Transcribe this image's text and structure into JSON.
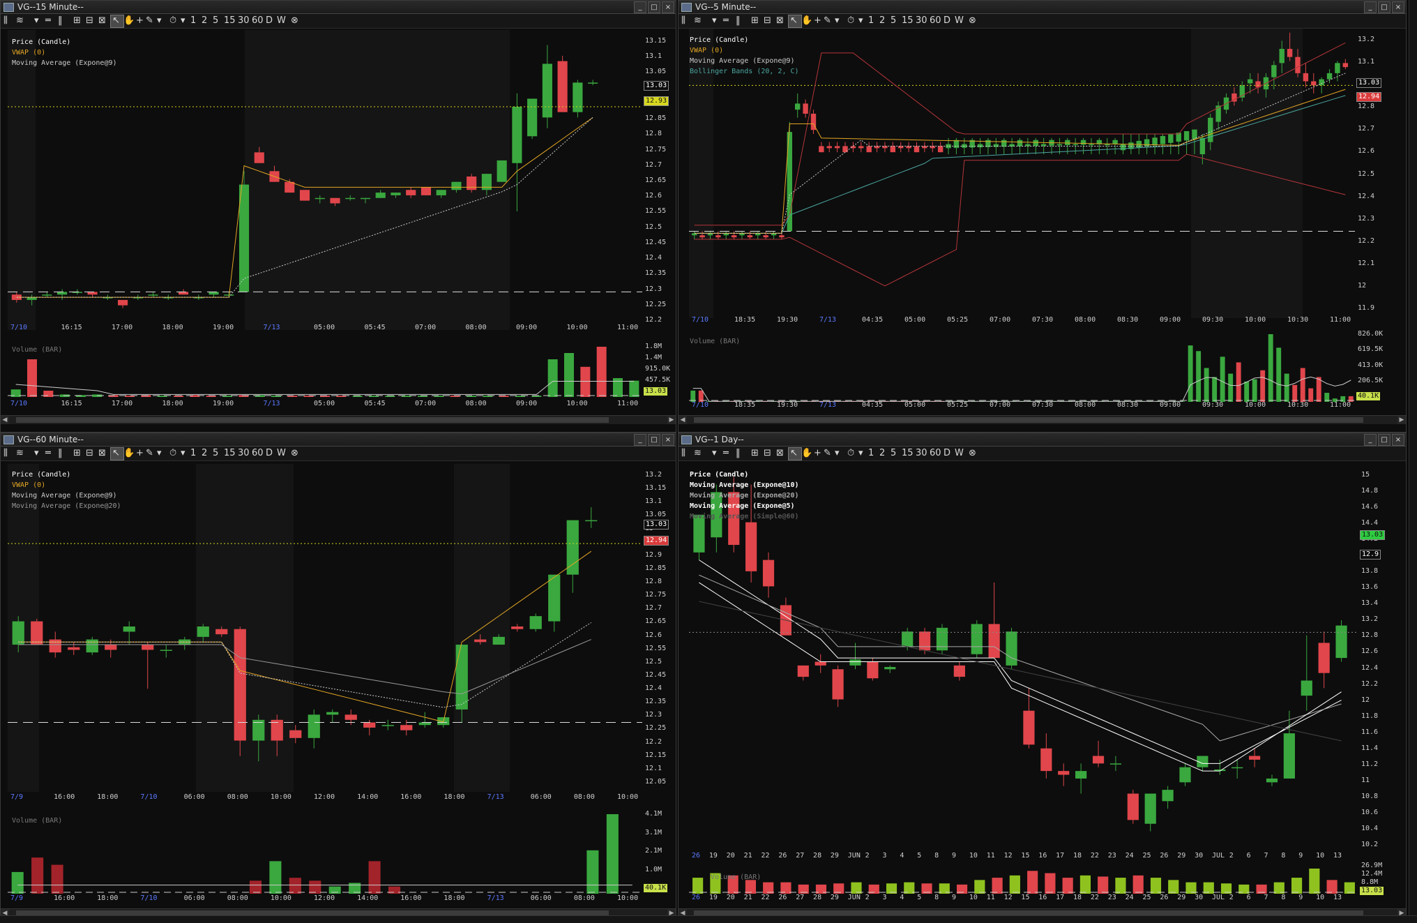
{
  "windows": [
    {
      "title": "VG--15 Minute--",
      "legend": [
        {
          "text": "Price (Candle)",
          "color": "#ffffff"
        },
        {
          "text": "VWAP (0)",
          "color": "#e3a524"
        },
        {
          "text": "Moving Average (Expone@9)",
          "color": "#cccccc"
        }
      ],
      "y_ticks": [
        "13.15",
        "13.1",
        "13.05",
        "13",
        "12.9",
        "12.85",
        "12.8",
        "12.75",
        "12.7",
        "12.65",
        "12.6",
        "12.55",
        "12.5",
        "12.45",
        "12.4",
        "12.35",
        "12.3",
        "12.25",
        "12.2"
      ],
      "x_ticks": [
        "7/10",
        "16:15",
        "17:00",
        "18:00",
        "19:00",
        "7/13",
        "05:00",
        "05:45",
        "07:00",
        "08:00",
        "09:00",
        "10:00",
        "11:00"
      ],
      "tags": [
        {
          "text": "13.03",
          "color": "#ffffff",
          "bg": "#0d0d0d"
        },
        {
          "text": "12.93",
          "color": "#111111",
          "bg": "#d8d820"
        }
      ],
      "volume_label": "Volume (BAR)",
      "vol_ticks": [
        "1.8M",
        "1.4M",
        "915.0K",
        "457.5K"
      ],
      "vol_tag": "13.03"
    },
    {
      "title": "VG--5 Minute--",
      "legend": [
        {
          "text": "Price (Candle)",
          "color": "#ffffff"
        },
        {
          "text": "VWAP (0)",
          "color": "#e3a524"
        },
        {
          "text": "Moving Average (Expone@9)",
          "color": "#cccccc"
        },
        {
          "text": "Bollinger Bands (20, 2, C)",
          "color": "#4aa6a0"
        }
      ],
      "y_ticks": [
        "13.2",
        "13.1",
        "12.9",
        "12.8",
        "12.7",
        "12.6",
        "12.5",
        "12.4",
        "12.3",
        "12.2",
        "12.1",
        "12",
        "11.9"
      ],
      "x_ticks": [
        "7/10",
        "18:35",
        "19:30",
        "7/13",
        "04:35",
        "05:00",
        "05:25",
        "07:00",
        "07:30",
        "08:00",
        "08:30",
        "09:00",
        "09:30",
        "10:00",
        "10:30",
        "11:00"
      ],
      "tags": [
        {
          "text": "13.03",
          "color": "#ffffff",
          "bg": "#0d0d0d"
        },
        {
          "text": "12.94",
          "color": "#ffffff",
          "bg": "#d93b3b"
        }
      ],
      "volume_label": "Volume (BAR)",
      "vol_ticks": [
        "826.0K",
        "619.5K",
        "413.0K",
        "206.5K"
      ],
      "vol_tag": "40.1K"
    },
    {
      "title": "VG--60 Minute--",
      "legend": [
        {
          "text": "Price (Candle)",
          "color": "#ffffff"
        },
        {
          "text": "VWAP (0)",
          "color": "#e3a524"
        },
        {
          "text": "Moving Average (Expone@9)",
          "color": "#cccccc"
        },
        {
          "text": "Moving Average (Expone@20)",
          "color": "#999999"
        }
      ],
      "y_ticks": [
        "13.2",
        "13.15",
        "13.1",
        "13.05",
        "13",
        "12.95",
        "12.9",
        "12.85",
        "12.8",
        "12.75",
        "12.7",
        "12.65",
        "12.6",
        "12.55",
        "12.5",
        "12.45",
        "12.4",
        "12.35",
        "12.3",
        "12.25",
        "12.2",
        "12.15",
        "12.1",
        "12.05"
      ],
      "x_ticks": [
        "7/9",
        "16:00",
        "18:00",
        "7/10",
        "06:00",
        "08:00",
        "10:00",
        "12:00",
        "14:00",
        "16:00",
        "18:00",
        "7/13",
        "06:00",
        "08:00",
        "10:00"
      ],
      "tags": [
        {
          "text": "13.03",
          "color": "#ffffff",
          "bg": "#0d0d0d"
        },
        {
          "text": "12.94",
          "color": "#ffffff",
          "bg": "#d93b3b"
        }
      ],
      "volume_label": "Volume (BAR)",
      "vol_ticks": [
        "4.1M",
        "3.1M",
        "2.1M",
        "1.0M"
      ],
      "vol_tag": "40.1K"
    },
    {
      "title": "VG--1 Day--",
      "legend": [
        {
          "text": "Price (Candle)",
          "color": "#ffffff"
        },
        {
          "text": "Moving Average (Expone@10)",
          "color": "#ffffff"
        },
        {
          "text": "Moving Average (Expone@20)",
          "color": "#aaaaaa"
        },
        {
          "text": "Moving Average (Expone@5)",
          "color": "#ffffff"
        },
        {
          "text": "Moving Average (Simple@60)",
          "color": "#555555"
        }
      ],
      "y_ticks": [
        "15",
        "14.8",
        "14.6",
        "14.4",
        "14.2",
        "14",
        "13.8",
        "13.6",
        "13.4",
        "13.2",
        "12.8",
        "12.6",
        "12.4",
        "12.2",
        "12",
        "11.8",
        "11.6",
        "11.4",
        "11.2",
        "11",
        "10.8",
        "10.6",
        "10.4",
        "10.2"
      ],
      "x_ticks": [
        "26",
        "19",
        "20",
        "21",
        "22",
        "26",
        "27",
        "28",
        "29",
        "JUN",
        "2",
        "3",
        "4",
        "5",
        "8",
        "9",
        "10",
        "11",
        "12",
        "15",
        "16",
        "17",
        "18",
        "22",
        "23",
        "24",
        "25",
        "26",
        "29",
        "30",
        "JUL",
        "2",
        "6",
        "7",
        "8",
        "9",
        "10",
        "13"
      ],
      "tags": [
        {
          "text": "13.03",
          "color": "#111111",
          "bg": "#2ecc40"
        },
        {
          "text": "12.9",
          "color": "#ffffff",
          "bg": "#0d0d0d"
        }
      ],
      "volume_label": "Volume (BAR)",
      "vol_ticks": [
        "26.9M",
        "12.4M",
        "8.8M"
      ],
      "vol_tag": "13.03"
    }
  ],
  "toolbar": {
    "periods": [
      "1",
      "2",
      "5",
      "15",
      "30",
      "60",
      "D",
      "W"
    ]
  },
  "colors": {
    "up": "#3aa83f",
    "down": "#e0464b",
    "vwap": "#e3a524",
    "grid": "#1c1c1c"
  }
}
